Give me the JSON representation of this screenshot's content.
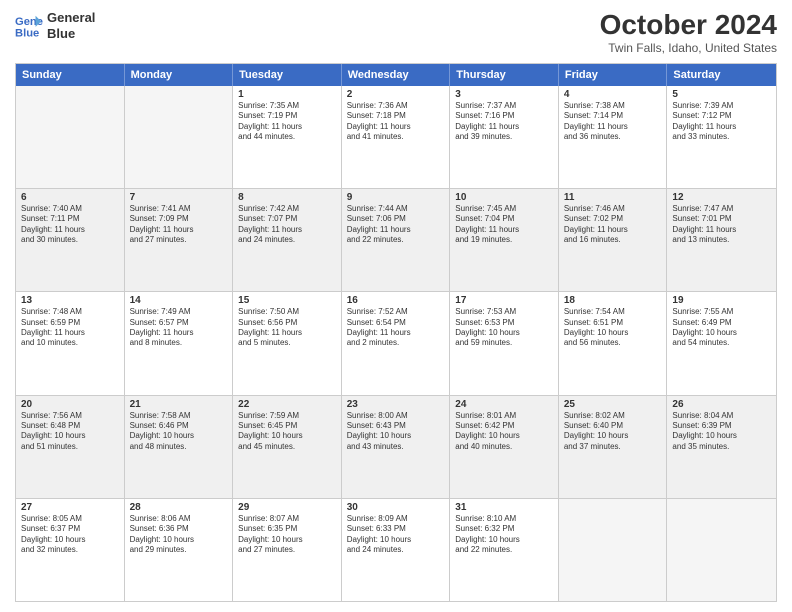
{
  "logo": {
    "line1": "General",
    "line2": "Blue"
  },
  "title": "October 2024",
  "location": "Twin Falls, Idaho, United States",
  "days": [
    "Sunday",
    "Monday",
    "Tuesday",
    "Wednesday",
    "Thursday",
    "Friday",
    "Saturday"
  ],
  "weeks": [
    [
      {
        "day": "",
        "info": ""
      },
      {
        "day": "",
        "info": ""
      },
      {
        "day": "1",
        "info": "Sunrise: 7:35 AM\nSunset: 7:19 PM\nDaylight: 11 hours\nand 44 minutes."
      },
      {
        "day": "2",
        "info": "Sunrise: 7:36 AM\nSunset: 7:18 PM\nDaylight: 11 hours\nand 41 minutes."
      },
      {
        "day": "3",
        "info": "Sunrise: 7:37 AM\nSunset: 7:16 PM\nDaylight: 11 hours\nand 39 minutes."
      },
      {
        "day": "4",
        "info": "Sunrise: 7:38 AM\nSunset: 7:14 PM\nDaylight: 11 hours\nand 36 minutes."
      },
      {
        "day": "5",
        "info": "Sunrise: 7:39 AM\nSunset: 7:12 PM\nDaylight: 11 hours\nand 33 minutes."
      }
    ],
    [
      {
        "day": "6",
        "info": "Sunrise: 7:40 AM\nSunset: 7:11 PM\nDaylight: 11 hours\nand 30 minutes."
      },
      {
        "day": "7",
        "info": "Sunrise: 7:41 AM\nSunset: 7:09 PM\nDaylight: 11 hours\nand 27 minutes."
      },
      {
        "day": "8",
        "info": "Sunrise: 7:42 AM\nSunset: 7:07 PM\nDaylight: 11 hours\nand 24 minutes."
      },
      {
        "day": "9",
        "info": "Sunrise: 7:44 AM\nSunset: 7:06 PM\nDaylight: 11 hours\nand 22 minutes."
      },
      {
        "day": "10",
        "info": "Sunrise: 7:45 AM\nSunset: 7:04 PM\nDaylight: 11 hours\nand 19 minutes."
      },
      {
        "day": "11",
        "info": "Sunrise: 7:46 AM\nSunset: 7:02 PM\nDaylight: 11 hours\nand 16 minutes."
      },
      {
        "day": "12",
        "info": "Sunrise: 7:47 AM\nSunset: 7:01 PM\nDaylight: 11 hours\nand 13 minutes."
      }
    ],
    [
      {
        "day": "13",
        "info": "Sunrise: 7:48 AM\nSunset: 6:59 PM\nDaylight: 11 hours\nand 10 minutes."
      },
      {
        "day": "14",
        "info": "Sunrise: 7:49 AM\nSunset: 6:57 PM\nDaylight: 11 hours\nand 8 minutes."
      },
      {
        "day": "15",
        "info": "Sunrise: 7:50 AM\nSunset: 6:56 PM\nDaylight: 11 hours\nand 5 minutes."
      },
      {
        "day": "16",
        "info": "Sunrise: 7:52 AM\nSunset: 6:54 PM\nDaylight: 11 hours\nand 2 minutes."
      },
      {
        "day": "17",
        "info": "Sunrise: 7:53 AM\nSunset: 6:53 PM\nDaylight: 10 hours\nand 59 minutes."
      },
      {
        "day": "18",
        "info": "Sunrise: 7:54 AM\nSunset: 6:51 PM\nDaylight: 10 hours\nand 56 minutes."
      },
      {
        "day": "19",
        "info": "Sunrise: 7:55 AM\nSunset: 6:49 PM\nDaylight: 10 hours\nand 54 minutes."
      }
    ],
    [
      {
        "day": "20",
        "info": "Sunrise: 7:56 AM\nSunset: 6:48 PM\nDaylight: 10 hours\nand 51 minutes."
      },
      {
        "day": "21",
        "info": "Sunrise: 7:58 AM\nSunset: 6:46 PM\nDaylight: 10 hours\nand 48 minutes."
      },
      {
        "day": "22",
        "info": "Sunrise: 7:59 AM\nSunset: 6:45 PM\nDaylight: 10 hours\nand 45 minutes."
      },
      {
        "day": "23",
        "info": "Sunrise: 8:00 AM\nSunset: 6:43 PM\nDaylight: 10 hours\nand 43 minutes."
      },
      {
        "day": "24",
        "info": "Sunrise: 8:01 AM\nSunset: 6:42 PM\nDaylight: 10 hours\nand 40 minutes."
      },
      {
        "day": "25",
        "info": "Sunrise: 8:02 AM\nSunset: 6:40 PM\nDaylight: 10 hours\nand 37 minutes."
      },
      {
        "day": "26",
        "info": "Sunrise: 8:04 AM\nSunset: 6:39 PM\nDaylight: 10 hours\nand 35 minutes."
      }
    ],
    [
      {
        "day": "27",
        "info": "Sunrise: 8:05 AM\nSunset: 6:37 PM\nDaylight: 10 hours\nand 32 minutes."
      },
      {
        "day": "28",
        "info": "Sunrise: 8:06 AM\nSunset: 6:36 PM\nDaylight: 10 hours\nand 29 minutes."
      },
      {
        "day": "29",
        "info": "Sunrise: 8:07 AM\nSunset: 6:35 PM\nDaylight: 10 hours\nand 27 minutes."
      },
      {
        "day": "30",
        "info": "Sunrise: 8:09 AM\nSunset: 6:33 PM\nDaylight: 10 hours\nand 24 minutes."
      },
      {
        "day": "31",
        "info": "Sunrise: 8:10 AM\nSunset: 6:32 PM\nDaylight: 10 hours\nand 22 minutes."
      },
      {
        "day": "",
        "info": ""
      },
      {
        "day": "",
        "info": ""
      }
    ]
  ]
}
